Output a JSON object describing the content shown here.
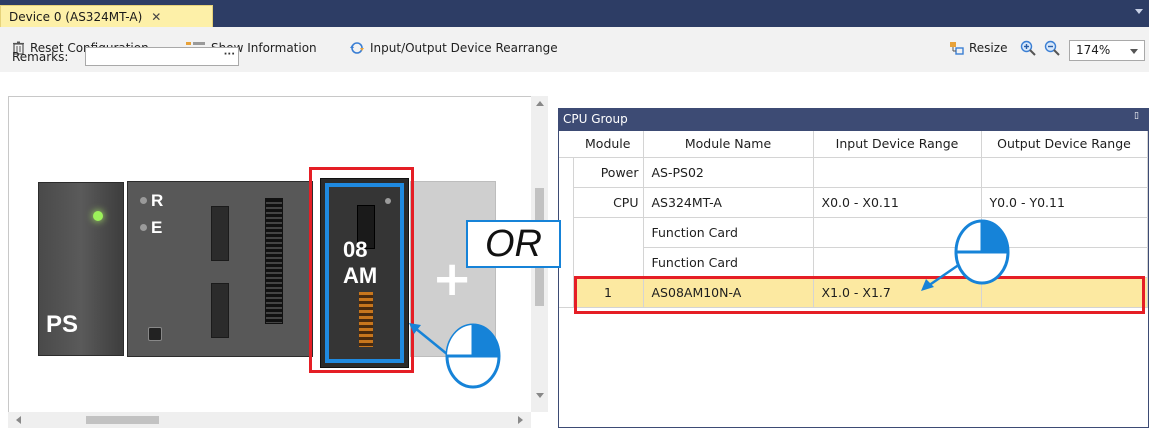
{
  "tab": {
    "title": "Device 0 (AS324MT-A)",
    "close": "✕"
  },
  "toolbar": {
    "reset": "Reset Configuration",
    "show_info": "Show Information",
    "rearrange": "Input/Output Device Rearrange",
    "resize": "Resize",
    "zoom_value": "174%"
  },
  "remarks": {
    "label": "Remarks:",
    "value": "",
    "button": "···"
  },
  "hardware": {
    "ps_label": "PS",
    "cpu_r": "R",
    "cpu_e": "E",
    "module_line1": "08",
    "module_line2": "AM",
    "add_symbol": "+"
  },
  "callout": {
    "or_text": "OR"
  },
  "cpu_group": {
    "title": "CPU Group",
    "columns": [
      "Module",
      "Module Name",
      "Input Device Range",
      "Output Device Range"
    ],
    "rows": [
      {
        "module": "Power",
        "name": "AS-PS02",
        "input": "",
        "output": ""
      },
      {
        "module": "CPU",
        "name": "AS324MT-A",
        "input": "X0.0 - X0.11",
        "output": "Y0.0 - Y0.11"
      },
      {
        "module": "",
        "name": "Function Card",
        "input": "",
        "output": ""
      },
      {
        "module": "",
        "name": "Function Card",
        "input": "",
        "output": ""
      },
      {
        "module": "1",
        "name": "AS08AM10N-A",
        "input": "X1.0 - X1.7",
        "output": ""
      }
    ]
  },
  "colors": {
    "tab_bg": "#fdf0a8",
    "header_bg": "#3d4b74",
    "highlight": "#e51e25",
    "selection": "#fce9a1",
    "accent_blue": "#1683d8"
  }
}
